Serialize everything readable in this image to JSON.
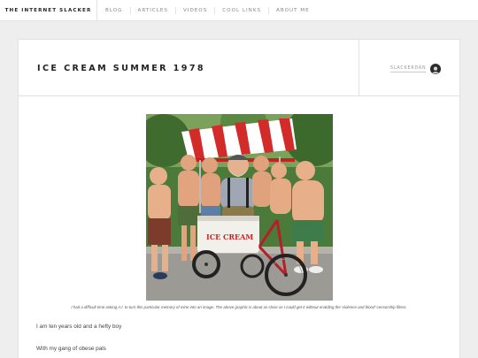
{
  "site": {
    "brand": "THE INTERNET SLACKER"
  },
  "nav": {
    "items": [
      "BLOG",
      "ARTICLES",
      "VIDEOS",
      "COOL LINKS",
      "ABOUT ME"
    ]
  },
  "post": {
    "title": "ICE CREAM SUMMER 1978",
    "author": "SLACKERDAN",
    "image_sign_text": "ICE CREAM",
    "caption": "I had a difficult time asking A.I. to turn this particular memory of mine into an image. The above graphic is about as close as I could get it without enabling the 'violence and blood' censorship filters.",
    "paragraphs": [
      "I am ten years old and a hefty boy",
      "With my gang of obese pals"
    ]
  },
  "icons": {
    "avatar": "author-avatar-icon"
  }
}
